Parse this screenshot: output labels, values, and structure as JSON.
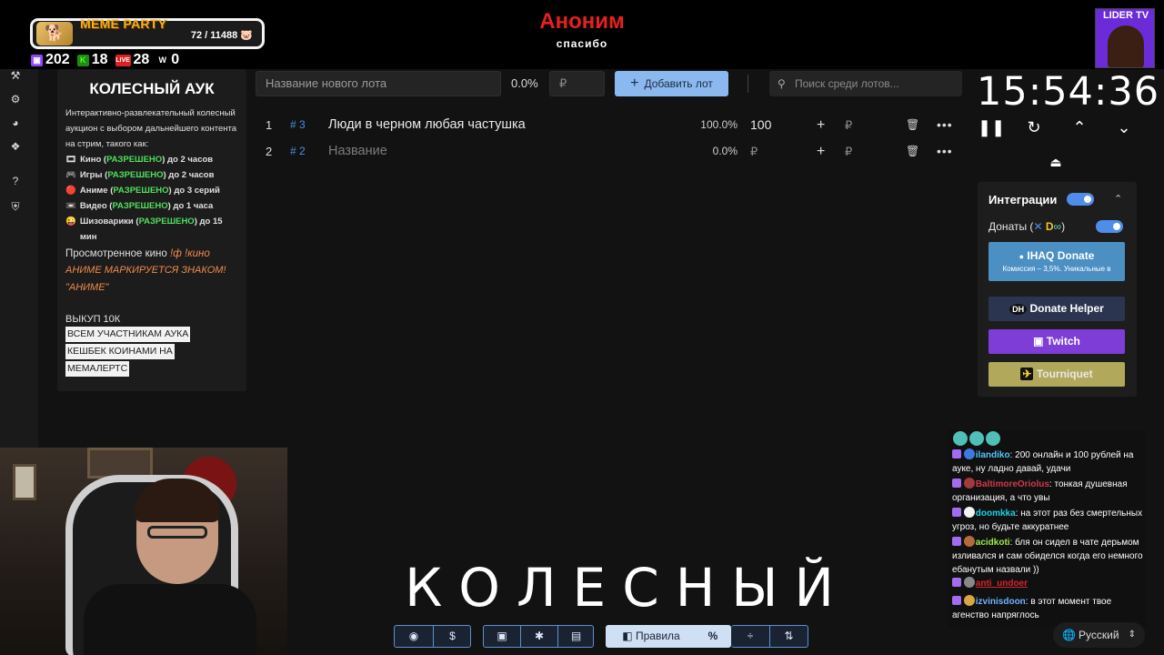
{
  "overlay": {
    "meme_party": {
      "title": "MEME PARTY",
      "count": "72 / 11488",
      "pig": "🐷"
    },
    "stats": [
      {
        "icon": "twitch-icon",
        "value": "202",
        "color": "#9146ff"
      },
      {
        "icon": "kick-icon",
        "value": "18",
        "color": "#53fc18"
      },
      {
        "icon": "live-icon",
        "value": "28",
        "color": "#e02020"
      },
      {
        "icon": "w-icon",
        "value": "0",
        "color": "#ffffff"
      }
    ],
    "donor": {
      "name": "Аноним",
      "sub": "спасибо"
    },
    "badge": {
      "label": "LIDER TV"
    }
  },
  "rules": {
    "title": "КОЛЕСНЫЙ АУК",
    "intro": "Интерактивно-развлекательный колесный аукцион с выбором дальнейшего контента на стрим, такого как:",
    "items": [
      {
        "icon": "🎞",
        "label": "Кино",
        "status": "РАЗРЕШЕНО",
        "limit": "до 2 часов"
      },
      {
        "icon": "🎮",
        "label": "Игры",
        "status": "РАЗРЕШЕНО",
        "limit": "до 2 часов"
      },
      {
        "icon": "🔴",
        "label": "Аниме",
        "status": "РАЗРЕШЕНО",
        "limit": "до 3 серий"
      },
      {
        "icon": "📼",
        "label": "Видео",
        "status": "РАЗРЕШЕНО",
        "limit": "до 1 часа"
      },
      {
        "icon": "😜",
        "label": "Шизоварики",
        "status": "РАЗРЕШЕНО",
        "limit": "до 15 мин"
      }
    ],
    "watched_label": "Просмотренное кино",
    "watched_cmd": "!ф !кино",
    "anime_note": "АНИМЕ МАРКИРУЕТСЯ ЗНАКОМ! \"АНИМЕ\"",
    "buyout": "ВЫКУП 10К",
    "highlight": [
      "ВСЕМ УЧАСТНИКАМ АУКА",
      "КЕШБЕК КОИНАМИ НА",
      "МЕМАЛЕРТС"
    ]
  },
  "toolbar": {
    "lot_placeholder": "Название нового лота",
    "percent": "0.0%",
    "currency": "₽",
    "add_label": "Добавить лот",
    "search_placeholder": "Поиск среди лотов..."
  },
  "lots": [
    {
      "index": "1",
      "id": "# 3",
      "name": "Люди в черном любая частушка",
      "percent": "100.0%",
      "amount": "100",
      "placeholder": false
    },
    {
      "index": "2",
      "id": "# 2",
      "name": "Название",
      "percent": "0.0%",
      "amount": "₽",
      "placeholder": true
    }
  ],
  "timer": {
    "time": "15:54:36"
  },
  "integrations": {
    "title": "Интеграции",
    "donates_label": "Донаты (",
    "donates_close": ")",
    "ihaq_label": "IHAQ Donate",
    "ihaq_sub": "Комиссия – 3,5%. Уникальные в",
    "donate_helper": "Donate Helper",
    "twitch": "Twitch",
    "tourniquet": "Tourniquet"
  },
  "bigword": "КОЛЕСНЫЙ",
  "bottom_toolbar": {
    "rules_label": "Правила"
  },
  "chat": [
    {
      "user": "ilandiko",
      "text": "200 онлайн и 100 рублей на ауке, ну ладно давай, удачи"
    },
    {
      "user": "BaltimoreOriolus",
      "text": "тонкая душевная организация, а что увы"
    },
    {
      "user": "doomkka",
      "text": "на этот раз без смертельных угроз, но будьте аккуратнее"
    },
    {
      "user": "acidkoti",
      "text": "бля он сидел в чате дерьмом изливался и сам обиделся когда его немного ебанутым назвали ))"
    },
    {
      "user": "anti_undoer",
      "text": ""
    },
    {
      "user": "izvinisdoon",
      "text": "в этот момент твое агенство напряглось"
    }
  ],
  "language": {
    "label": "Русский"
  }
}
